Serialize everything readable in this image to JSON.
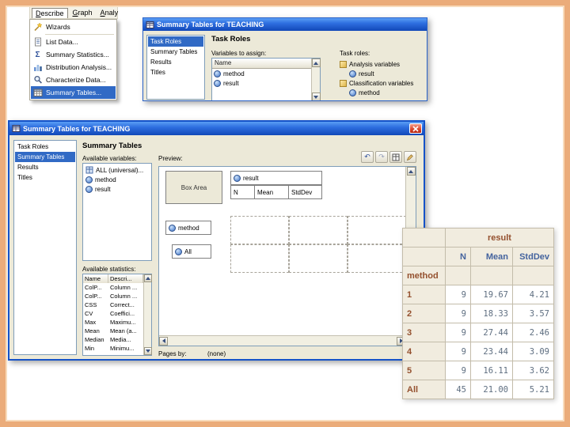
{
  "colors": {
    "selection": "#316AC5",
    "dialog_bg": "#ECE9D8",
    "frame": "#EBAC7A",
    "header_maroon": "#94502E",
    "header_blue": "#44639E"
  },
  "menu_window": {
    "menubar": [
      "Describe",
      "Graph",
      "Analy"
    ],
    "items": [
      {
        "label": "Wizards"
      },
      {
        "label": "List Data..."
      },
      {
        "label": "Summary Statistics..."
      },
      {
        "label": "Distribution Analysis..."
      },
      {
        "label": "Characterize Data..."
      },
      {
        "label": "Summary Tables..."
      }
    ]
  },
  "task_roles_window": {
    "title": "Summary Tables for TEACHING",
    "sidebar": [
      "Task Roles",
      "Summary Tables",
      "Results",
      "Titles"
    ],
    "heading": "Task Roles",
    "variables_label": "Variables to assign:",
    "variables_header": "Name",
    "variables": [
      "method",
      "result"
    ],
    "task_roles_label": "Task roles:",
    "roles": [
      {
        "label": "Analysis variables",
        "children": [
          "result"
        ]
      },
      {
        "label": "Classification variables",
        "children": [
          "method"
        ]
      }
    ]
  },
  "summary_window": {
    "title": "Summary Tables for TEACHING",
    "sidebar": [
      "Task Roles",
      "Summary Tables",
      "Results",
      "Titles"
    ],
    "heading": "Summary Tables",
    "available_variables_label": "Available variables:",
    "available_variables": [
      "ALL (universal)...",
      "method",
      "result"
    ],
    "preview_label": "Preview:",
    "box_area_label": "Box Area",
    "column_variable": "result",
    "column_stats": [
      "N",
      "Mean",
      "StdDev"
    ],
    "row_zones": [
      "method",
      "All"
    ],
    "pages_by_label": "Pages by:",
    "pages_by_value": "(none)",
    "available_statistics_label": "Available statistics:",
    "statistics_columns": [
      "Name",
      "Descri..."
    ],
    "statistics": [
      {
        "name": "ColP...",
        "description": "Column ..."
      },
      {
        "name": "ColP...",
        "description": "Column ..."
      },
      {
        "name": "CSS",
        "description": "Correct..."
      },
      {
        "name": "CV",
        "description": "Coeffici..."
      },
      {
        "name": "Max",
        "description": "Maximu..."
      },
      {
        "name": "Mean",
        "description": "Mean (a..."
      },
      {
        "name": "Median",
        "description": "Media..."
      },
      {
        "name": "Min",
        "description": "Minimu..."
      }
    ]
  },
  "results_table": {
    "column_group": "result",
    "columns": [
      "N",
      "Mean",
      "StdDev"
    ],
    "row_group": "method",
    "rows": [
      {
        "label": "1",
        "n": "9",
        "mean": "19.67",
        "stddev": "4.21"
      },
      {
        "label": "2",
        "n": "9",
        "mean": "18.33",
        "stddev": "3.57"
      },
      {
        "label": "3",
        "n": "9",
        "mean": "27.44",
        "stddev": "2.46"
      },
      {
        "label": "4",
        "n": "9",
        "mean": "23.44",
        "stddev": "3.09"
      },
      {
        "label": "5",
        "n": "9",
        "mean": "16.11",
        "stddev": "3.62"
      },
      {
        "label": "All",
        "n": "45",
        "mean": "21.00",
        "stddev": "5.21"
      }
    ]
  }
}
